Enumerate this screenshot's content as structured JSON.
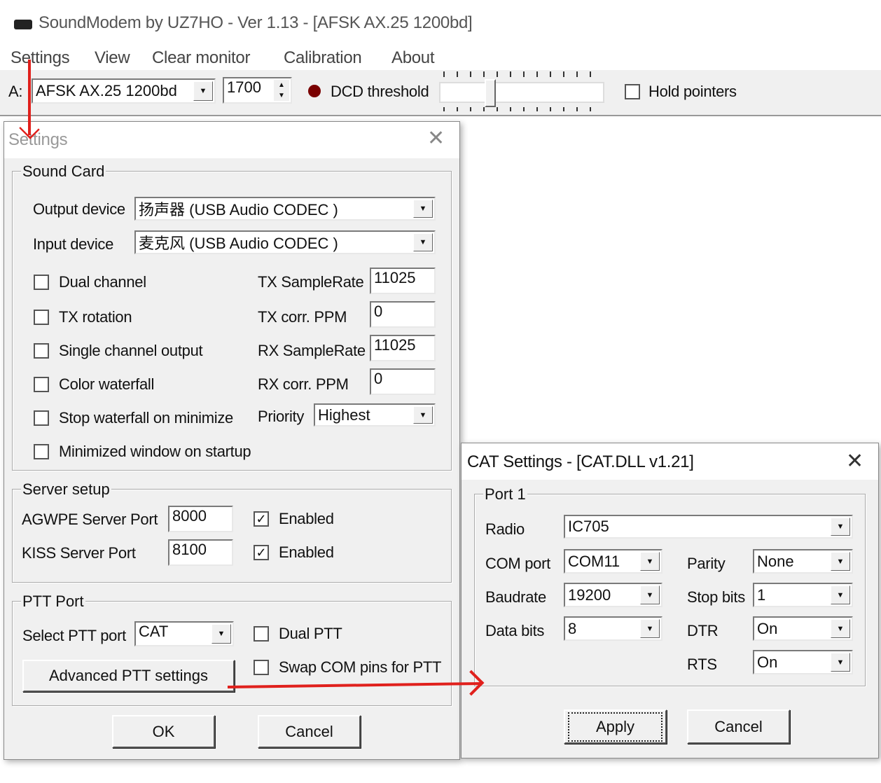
{
  "window": {
    "title": "SoundModem by UZ7HO - Ver 1.13 - [AFSK AX.25 1200bd]"
  },
  "menu": [
    "Settings",
    "View",
    "Clear monitor",
    "Calibration",
    "About"
  ],
  "toolbar": {
    "channel_label": "A:",
    "modem": "AFSK AX.25 1200bd",
    "frequency": "1700",
    "dcd_label": "DCD threshold",
    "dcd_value_fraction": 0.3,
    "hold_pointers": "Hold pointers",
    "dcd_color": "#7a0000"
  },
  "settings": {
    "title": "Settings",
    "sound_card": {
      "label": "Sound Card",
      "output_label": "Output device",
      "output_value": "扬声器 (USB Audio CODEC )",
      "input_label": "Input device",
      "input_value": "麦克风 (USB Audio CODEC )",
      "checkboxes": [
        "Dual channel",
        "TX rotation",
        "Single channel output",
        "Color waterfall",
        "Stop waterfall on minimize",
        "Minimized window on startup"
      ],
      "tx_samplerate_label": "TX SampleRate",
      "tx_samplerate": "11025",
      "tx_ppm_label": "TX corr. PPM",
      "tx_ppm": "0",
      "rx_samplerate_label": "RX SampleRate",
      "rx_samplerate": "11025",
      "rx_ppm_label": "RX corr. PPM",
      "rx_ppm": "0",
      "priority_label": "Priority",
      "priority": "Highest"
    },
    "server": {
      "label": "Server setup",
      "agwpe_label": "AGWPE Server Port",
      "agwpe_port": "8000",
      "kiss_label": "KISS Server Port",
      "kiss_port": "8100",
      "enabled": "Enabled"
    },
    "ptt": {
      "label": "PTT Port",
      "select_label": "Select PTT port",
      "select_value": "CAT",
      "dual_ptt": "Dual PTT",
      "advanced": "Advanced PTT settings",
      "swap": "Swap COM pins for PTT"
    },
    "ok": "OK",
    "cancel": "Cancel"
  },
  "cat": {
    "title": "CAT Settings - [CAT.DLL v1.21]",
    "group": "Port 1",
    "radio_label": "Radio",
    "radio": "IC705",
    "com_label": "COM port",
    "com": "COM11",
    "baud_label": "Baudrate",
    "baud": "19200",
    "data_label": "Data bits",
    "data": "8",
    "parity_label": "Parity",
    "parity": "None",
    "stop_label": "Stop bits",
    "stop": "1",
    "dtr_label": "DTR",
    "dtr": "On",
    "rts_label": "RTS",
    "rts": "On",
    "apply": "Apply",
    "cancel": "Cancel"
  }
}
